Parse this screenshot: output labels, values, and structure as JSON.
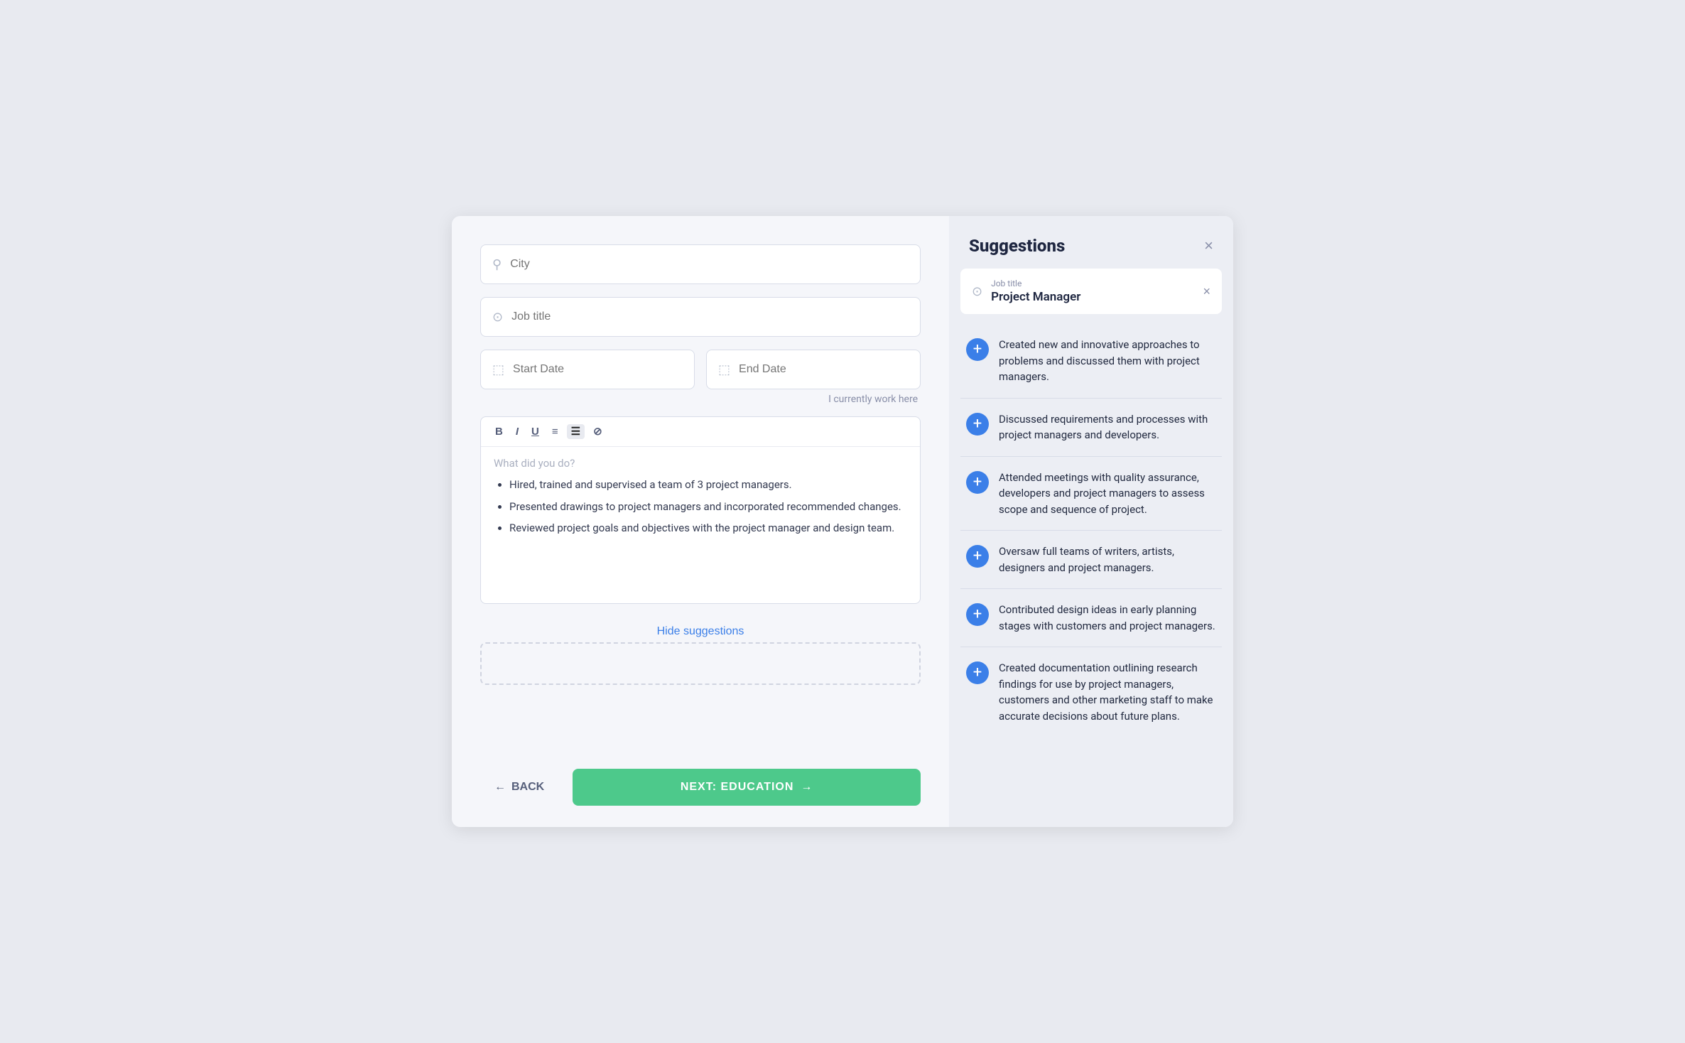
{
  "left": {
    "city_placeholder": "City",
    "job_title_placeholder": "Job title",
    "start_date_placeholder": "Start Date",
    "end_date_placeholder": "End Date",
    "currently_work_label": "I currently work here",
    "editor_placeholder": "What did you do?",
    "bullets": [
      "Hired, trained and supervised a team of 3 project managers.",
      "Presented drawings to project managers and incorporated recommended changes.",
      "Reviewed project goals and objectives with the project manager and design team."
    ],
    "hide_suggestions_label": "Hide suggestions",
    "back_label": "BACK",
    "next_label": "NEXT: EDUCATION"
  },
  "right": {
    "title": "Suggestions",
    "close_icon": "×",
    "job_title_label": "Job title",
    "job_title_value": "Project Manager",
    "clear_icon": "×",
    "suggestions": [
      "Created new and innovative approaches to problems and discussed them with project managers.",
      "Discussed requirements and processes with project managers and developers.",
      "Attended meetings with quality assurance, developers and project managers to assess scope and sequence of project.",
      "Oversaw full teams of writers, artists, designers and project managers.",
      "Contributed design ideas in early planning stages with customers and project managers.",
      "Created documentation outlining research findings for use by project managers, customers and other marketing staff to make accurate decisions about future plans."
    ],
    "add_icon": "+"
  }
}
